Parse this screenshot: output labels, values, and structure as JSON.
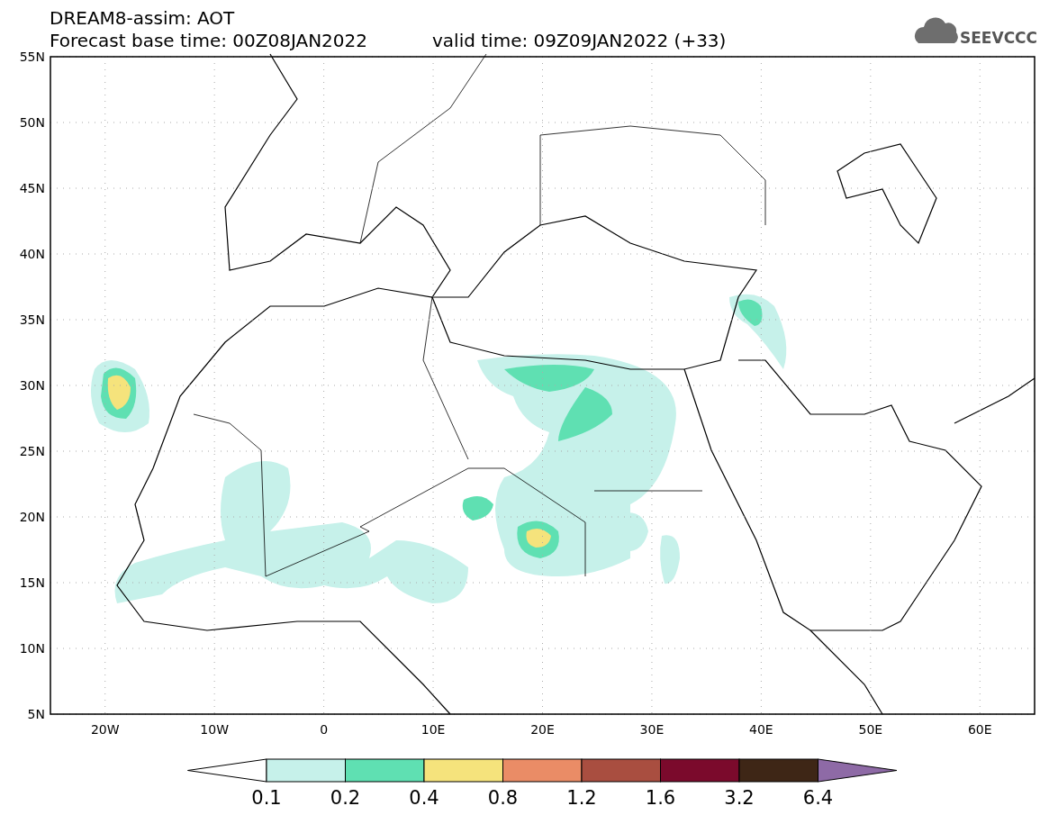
{
  "title": "DREAM8-assim: AOT",
  "base_time": "Forecast base time: 00Z08JAN2022",
  "valid_time": "valid time: 09Z09JAN2022 (+33)",
  "logo": "SEEVCCC",
  "lat_labels": [
    "55N",
    "50N",
    "45N",
    "40N",
    "35N",
    "30N",
    "25N",
    "20N",
    "15N",
    "10N",
    "5N"
  ],
  "lon_labels": [
    "20W",
    "10W",
    "0",
    "10E",
    "20E",
    "30E",
    "40E",
    "50E",
    "60E"
  ],
  "legend": {
    "bins": [
      {
        "kind": "under",
        "color": "#ffffff"
      },
      {
        "kind": "box",
        "color": "#c6f1ea"
      },
      {
        "kind": "box",
        "color": "#5fe0b2"
      },
      {
        "kind": "box",
        "color": "#f5e37c"
      },
      {
        "kind": "box",
        "color": "#ea8c66"
      },
      {
        "kind": "box",
        "color": "#a94e40"
      },
      {
        "kind": "box",
        "color": "#7b0a2c"
      },
      {
        "kind": "box",
        "color": "#3e2616"
      },
      {
        "kind": "over",
        "color": "#8e6aa6"
      }
    ],
    "labels": [
      "0.1",
      "0.2",
      "0.4",
      "0.8",
      "1.2",
      "1.6",
      "3.2",
      "6.4"
    ]
  }
}
